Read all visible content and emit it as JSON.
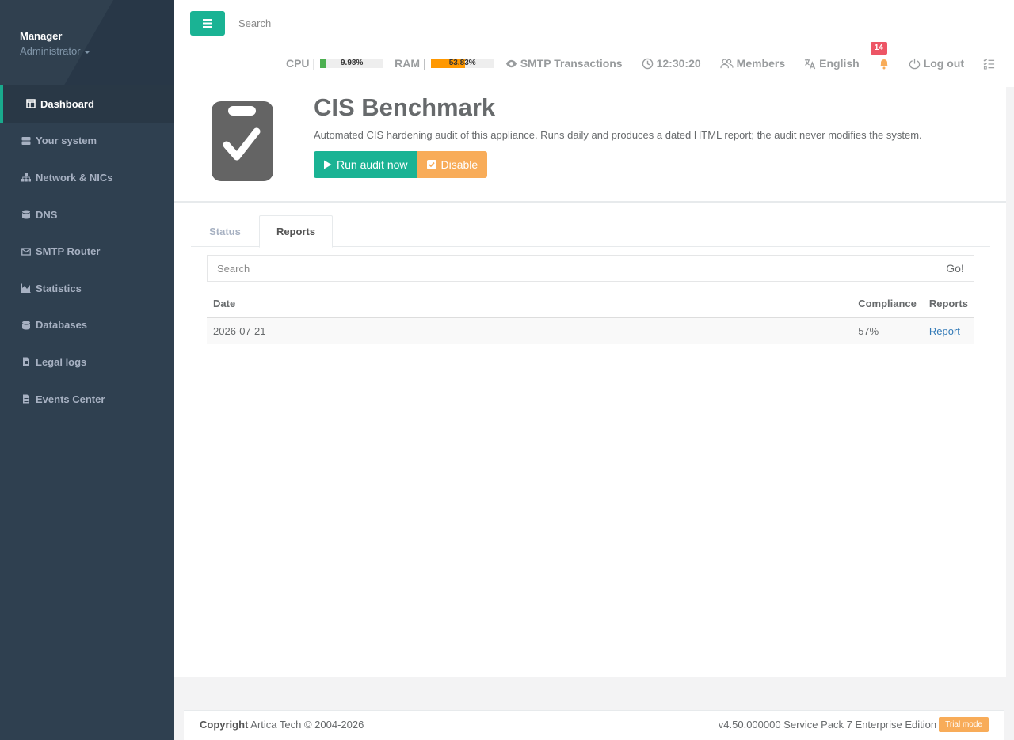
{
  "profile": {
    "name": "Manager",
    "role": "Administrator"
  },
  "sidebar": {
    "items": [
      {
        "label": "Dashboard",
        "icon": "dashboard-icon"
      },
      {
        "label": "Your system",
        "icon": "server-icon"
      },
      {
        "label": "Network & NICs",
        "icon": "sitemap-icon"
      },
      {
        "label": "DNS",
        "icon": "database-icon"
      },
      {
        "label": "SMTP Router",
        "icon": "envelope-icon"
      },
      {
        "label": "Statistics",
        "icon": "area-chart-icon"
      },
      {
        "label": "Databases",
        "icon": "database-icon"
      },
      {
        "label": "Legal logs",
        "icon": "file-icon"
      },
      {
        "label": "Events Center",
        "icon": "file-text-icon"
      }
    ]
  },
  "topbar": {
    "search_placeholder": "Search",
    "cpu_label": "CPU",
    "cpu_value": "9.98%",
    "cpu_percent": 9.98,
    "ram_label": "RAM",
    "ram_value": "53.83%",
    "ram_percent": 53.83,
    "pipe": "|",
    "smtp_label": "SMTP Transactions",
    "time": "12:30:20",
    "members_label": "Members",
    "language": "English",
    "notifications_count": "14",
    "logout_label": "Log out"
  },
  "header": {
    "title": "CIS Benchmark",
    "description": "Automated CIS hardening audit of this appliance. Runs daily and produces a dated HTML report; the audit never modifies the system.",
    "run_label": "Run audit now",
    "disable_label": "Disable"
  },
  "tabs": {
    "status": "Status",
    "reports": "Reports"
  },
  "reports": {
    "search_placeholder": "Search",
    "go_label": "Go!",
    "columns": [
      "Date",
      "Compliance",
      "Reports"
    ],
    "rows": [
      {
        "date": "2026-07-21",
        "compliance": "57%",
        "report": "Report"
      }
    ]
  },
  "footer": {
    "copyright_bold": "Copyright",
    "copyright_text": "Artica Tech © 2004-2026",
    "version": "v4.50.000000 Service Pack 7 Enterprise Edition",
    "trial": "Trial mode"
  },
  "colors": {
    "primary": "#1ab394",
    "warning": "#f8ac59",
    "sidebar": "#2f4050",
    "cpu_bar": "#4caf50",
    "ram_bar": "#ff9800",
    "badge": "#ed5565"
  }
}
